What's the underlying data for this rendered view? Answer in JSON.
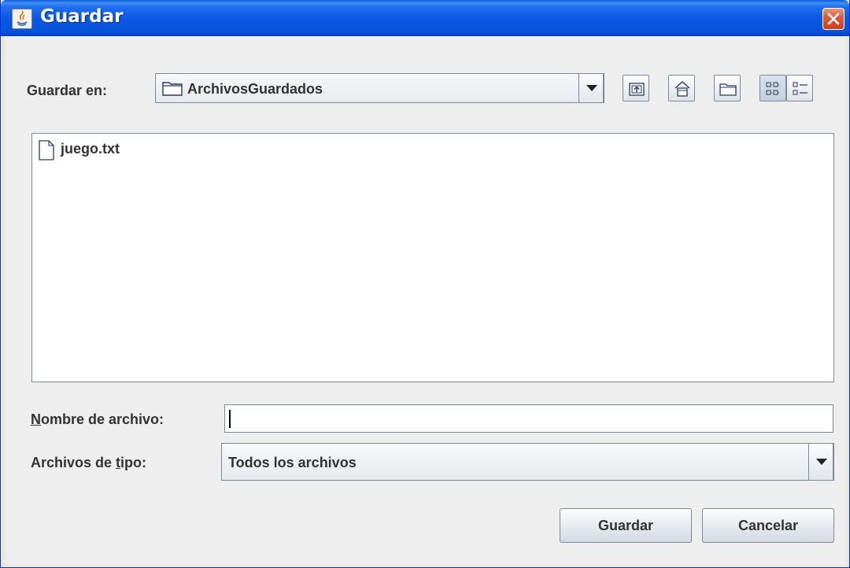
{
  "window": {
    "title": "Guardar"
  },
  "toolbar": {
    "look_in_label": "Guardar en:",
    "current_folder": "ArchivosGuardados",
    "buttons": [
      {
        "icon": "up-folder-icon"
      },
      {
        "icon": "home-icon"
      },
      {
        "icon": "new-folder-icon"
      },
      {
        "icon": "list-view-icon"
      },
      {
        "icon": "details-view-icon"
      }
    ]
  },
  "file_list": {
    "items": [
      {
        "name": "juego.txt",
        "icon": "file-icon"
      }
    ]
  },
  "file_name": {
    "label_first_letter": "N",
    "label_rest": "ombre de archivo:",
    "value": ""
  },
  "file_type": {
    "label_before": "Archivos de ",
    "label_mnemonic": "t",
    "label_after": "ipo:",
    "selected": "Todos los archivos"
  },
  "actions": {
    "save_label": "Guardar",
    "cancel_label": "Cancelar"
  },
  "colors": {
    "titlebar": "#0a56e0",
    "close_button": "#d95b3d",
    "dialog_background": "#eeeeee"
  }
}
